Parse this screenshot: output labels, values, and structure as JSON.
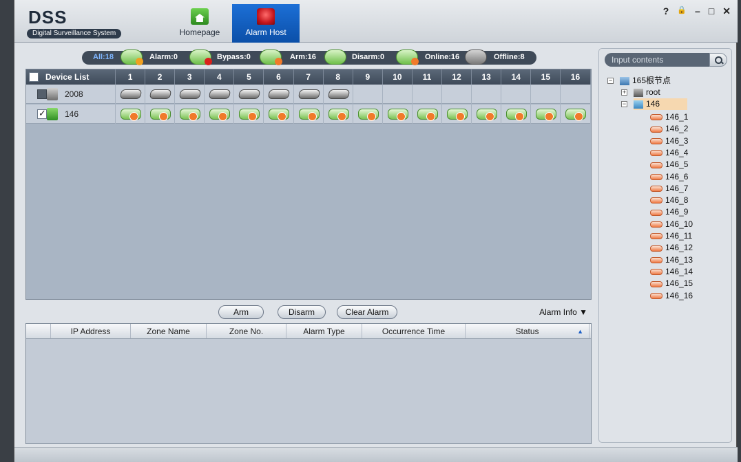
{
  "app": {
    "logo": "DSS",
    "subtitle": "Digital Surveillance System"
  },
  "nav": {
    "home": "Homepage",
    "alarm": "Alarm Host"
  },
  "window_controls": {
    "help": "?",
    "lock": "🔒",
    "min": "–",
    "max": "□",
    "close": "✕"
  },
  "status": {
    "all": "All:18",
    "alarm": "Alarm:0",
    "bypass": "Bypass:0",
    "arm": "Arm:16",
    "disarm": "Disarm:0",
    "online": "Online:16",
    "offline": "Offline:8"
  },
  "device_grid": {
    "header": "Device List",
    "columns": [
      "1",
      "2",
      "3",
      "4",
      "5",
      "6",
      "7",
      "8",
      "9",
      "10",
      "11",
      "12",
      "13",
      "14",
      "15",
      "16"
    ],
    "rows": [
      {
        "name": "2008",
        "checked": false,
        "zones": [
          "offline",
          "offline",
          "offline",
          "offline",
          "offline",
          "offline",
          "offline",
          "offline"
        ]
      },
      {
        "name": "146",
        "checked": true,
        "zones": [
          "arm",
          "arm",
          "arm",
          "arm",
          "arm",
          "arm",
          "arm",
          "arm",
          "arm",
          "arm",
          "arm",
          "arm",
          "arm",
          "arm",
          "arm",
          "arm"
        ]
      }
    ]
  },
  "actions": {
    "arm": "Arm",
    "disarm": "Disarm",
    "clear": "Clear Alarm",
    "alarm_info": "Alarm Info ▼"
  },
  "alarm_table": {
    "columns": [
      "IP Address",
      "Zone Name",
      "Zone No.",
      "Alarm Type",
      "Occurrence Time",
      "Status"
    ],
    "sort_indicator": "▲"
  },
  "search": {
    "placeholder": "Input contents"
  },
  "tree": {
    "root_label": "165根节点",
    "child_root": "root",
    "device": "146",
    "zones": [
      "146_1",
      "146_2",
      "146_3",
      "146_4",
      "146_5",
      "146_6",
      "146_7",
      "146_8",
      "146_9",
      "146_10",
      "146_11",
      "146_12",
      "146_13",
      "146_14",
      "146_15",
      "146_16"
    ]
  },
  "colors": {
    "accent": "#0b4fa8",
    "arm": "#7cc356",
    "zone_leaf": "#ef7a45",
    "header": "#3e4a59"
  }
}
